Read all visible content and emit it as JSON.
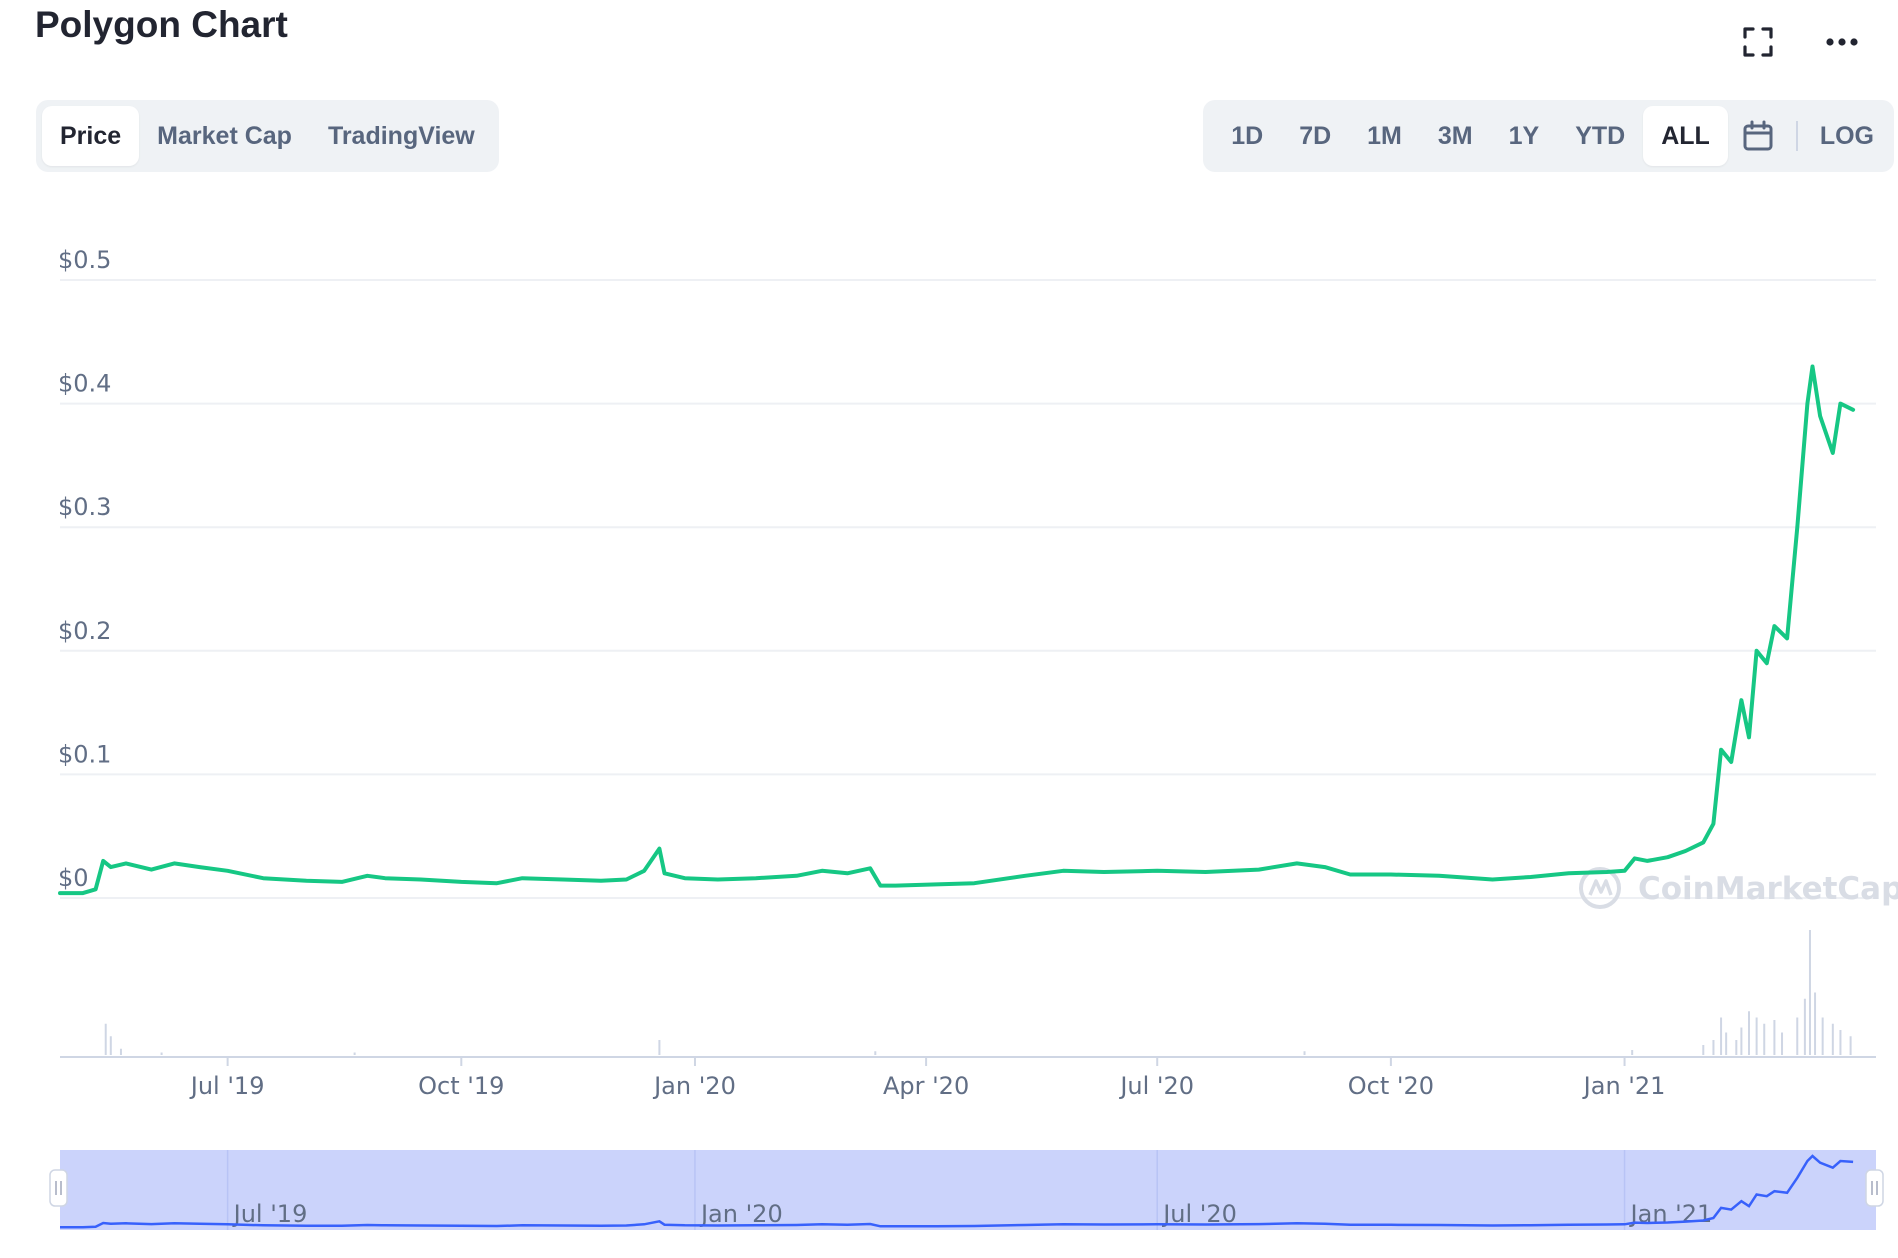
{
  "title": "Polygon Chart",
  "tabs": [
    {
      "label": "Price",
      "active": true
    },
    {
      "label": "Market Cap",
      "active": false
    },
    {
      "label": "TradingView",
      "active": false
    }
  ],
  "ranges": [
    {
      "label": "1D",
      "active": false
    },
    {
      "label": "7D",
      "active": false
    },
    {
      "label": "1M",
      "active": false
    },
    {
      "label": "3M",
      "active": false
    },
    {
      "label": "1Y",
      "active": false
    },
    {
      "label": "YTD",
      "active": false
    },
    {
      "label": "ALL",
      "active": true
    }
  ],
  "log_label": "LOG",
  "icons": {
    "fullscreen": "fullscreen-icon",
    "more": "more-dots-icon",
    "calendar": "calendar-icon"
  },
  "watermark": "CoinMarketCap",
  "colors": {
    "line": "#16c784",
    "navigator_fill": "#cbd3fb",
    "navigator_line": "#3861fb",
    "volume": "#cfd6e4"
  },
  "chart_data": {
    "type": "line",
    "title": "",
    "xlabel": "",
    "ylabel": "",
    "y_ticks": [
      "$0",
      "$0.1",
      "$0.2",
      "$0.3",
      "$0.4",
      "$0.5"
    ],
    "y_tick_values": [
      0,
      0.1,
      0.2,
      0.3,
      0.4,
      0.5
    ],
    "ylim": [
      0,
      0.5
    ],
    "xlim": [
      "2019-04-26",
      "2021-04-10"
    ],
    "x_ticks": [
      "Jul '19",
      "Oct '19",
      "Jan '20",
      "Apr '20",
      "Jul '20",
      "Oct '20",
      "Jan '21"
    ],
    "x_tick_dates": [
      "2019-07-01",
      "2019-10-01",
      "2020-01-01",
      "2020-04-01",
      "2020-07-01",
      "2020-10-01",
      "2021-01-01"
    ],
    "navigator_ticks": [
      "Jul '19",
      "Jan '20",
      "Jul '20",
      "Jan '21"
    ],
    "navigator_tick_dates": [
      "2019-07-01",
      "2020-01-01",
      "2020-07-01",
      "2021-01-01"
    ],
    "grid": true,
    "series": [
      {
        "points": [
          [
            "2019-04-26",
            0.004
          ],
          [
            "2019-05-05",
            0.004
          ],
          [
            "2019-05-10",
            0.007
          ],
          [
            "2019-05-13",
            0.03
          ],
          [
            "2019-05-16",
            0.025
          ],
          [
            "2019-05-22",
            0.028
          ],
          [
            "2019-06-01",
            0.023
          ],
          [
            "2019-06-10",
            0.028
          ],
          [
            "2019-06-20",
            0.025
          ],
          [
            "2019-07-01",
            0.022
          ],
          [
            "2019-07-15",
            0.016
          ],
          [
            "2019-08-01",
            0.014
          ],
          [
            "2019-08-15",
            0.013
          ],
          [
            "2019-08-25",
            0.018
          ],
          [
            "2019-09-01",
            0.016
          ],
          [
            "2019-09-15",
            0.015
          ],
          [
            "2019-10-01",
            0.013
          ],
          [
            "2019-10-15",
            0.012
          ],
          [
            "2019-10-25",
            0.016
          ],
          [
            "2019-11-10",
            0.015
          ],
          [
            "2019-11-25",
            0.014
          ],
          [
            "2019-12-05",
            0.015
          ],
          [
            "2019-12-12",
            0.022
          ],
          [
            "2019-12-18",
            0.04
          ],
          [
            "2019-12-20",
            0.02
          ],
          [
            "2019-12-28",
            0.016
          ],
          [
            "2020-01-10",
            0.015
          ],
          [
            "2020-01-25",
            0.016
          ],
          [
            "2020-02-10",
            0.018
          ],
          [
            "2020-02-20",
            0.022
          ],
          [
            "2020-03-01",
            0.02
          ],
          [
            "2020-03-10",
            0.024
          ],
          [
            "2020-03-14",
            0.01
          ],
          [
            "2020-03-20",
            0.01
          ],
          [
            "2020-04-05",
            0.011
          ],
          [
            "2020-04-20",
            0.012
          ],
          [
            "2020-05-10",
            0.018
          ],
          [
            "2020-05-25",
            0.022
          ],
          [
            "2020-06-10",
            0.021
          ],
          [
            "2020-07-01",
            0.022
          ],
          [
            "2020-07-20",
            0.021
          ],
          [
            "2020-08-10",
            0.023
          ],
          [
            "2020-08-25",
            0.028
          ],
          [
            "2020-09-05",
            0.025
          ],
          [
            "2020-09-15",
            0.019
          ],
          [
            "2020-10-01",
            0.019
          ],
          [
            "2020-10-20",
            0.018
          ],
          [
            "2020-11-10",
            0.015
          ],
          [
            "2020-11-25",
            0.017
          ],
          [
            "2020-12-10",
            0.02
          ],
          [
            "2020-12-25",
            0.021
          ],
          [
            "2021-01-01",
            0.022
          ],
          [
            "2021-01-05",
            0.032
          ],
          [
            "2021-01-10",
            0.03
          ],
          [
            "2021-01-18",
            0.033
          ],
          [
            "2021-01-25",
            0.038
          ],
          [
            "2021-02-01",
            0.045
          ],
          [
            "2021-02-05",
            0.06
          ],
          [
            "2021-02-08",
            0.12
          ],
          [
            "2021-02-12",
            0.11
          ],
          [
            "2021-02-16",
            0.16
          ],
          [
            "2021-02-19",
            0.13
          ],
          [
            "2021-02-22",
            0.2
          ],
          [
            "2021-02-26",
            0.19
          ],
          [
            "2021-03-01",
            0.22
          ],
          [
            "2021-03-06",
            0.21
          ],
          [
            "2021-03-10",
            0.3
          ],
          [
            "2021-03-14",
            0.4
          ],
          [
            "2021-03-16",
            0.43
          ],
          [
            "2021-03-19",
            0.39
          ],
          [
            "2021-03-24",
            0.36
          ],
          [
            "2021-03-27",
            0.4
          ],
          [
            "2021-04-01",
            0.395
          ]
        ]
      }
    ],
    "volume": [
      {
        "x": "2019-05-14",
        "v": 0.25
      },
      {
        "x": "2019-05-16",
        "v": 0.15
      },
      {
        "x": "2019-05-20",
        "v": 0.05
      },
      {
        "x": "2019-06-05",
        "v": 0.02
      },
      {
        "x": "2019-08-20",
        "v": 0.02
      },
      {
        "x": "2019-12-18",
        "v": 0.12
      },
      {
        "x": "2020-03-12",
        "v": 0.03
      },
      {
        "x": "2020-08-28",
        "v": 0.03
      },
      {
        "x": "2021-01-04",
        "v": 0.04
      },
      {
        "x": "2021-02-01",
        "v": 0.08
      },
      {
        "x": "2021-02-05",
        "v": 0.12
      },
      {
        "x": "2021-02-08",
        "v": 0.3
      },
      {
        "x": "2021-02-10",
        "v": 0.18
      },
      {
        "x": "2021-02-14",
        "v": 0.12
      },
      {
        "x": "2021-02-16",
        "v": 0.22
      },
      {
        "x": "2021-02-19",
        "v": 0.35
      },
      {
        "x": "2021-02-22",
        "v": 0.3
      },
      {
        "x": "2021-02-25",
        "v": 0.25
      },
      {
        "x": "2021-03-01",
        "v": 0.28
      },
      {
        "x": "2021-03-04",
        "v": 0.18
      },
      {
        "x": "2021-03-10",
        "v": 0.3
      },
      {
        "x": "2021-03-13",
        "v": 0.45
      },
      {
        "x": "2021-03-15",
        "v": 1.0
      },
      {
        "x": "2021-03-17",
        "v": 0.5
      },
      {
        "x": "2021-03-20",
        "v": 0.3
      },
      {
        "x": "2021-03-24",
        "v": 0.25
      },
      {
        "x": "2021-03-27",
        "v": 0.2
      },
      {
        "x": "2021-03-31",
        "v": 0.15
      }
    ]
  }
}
